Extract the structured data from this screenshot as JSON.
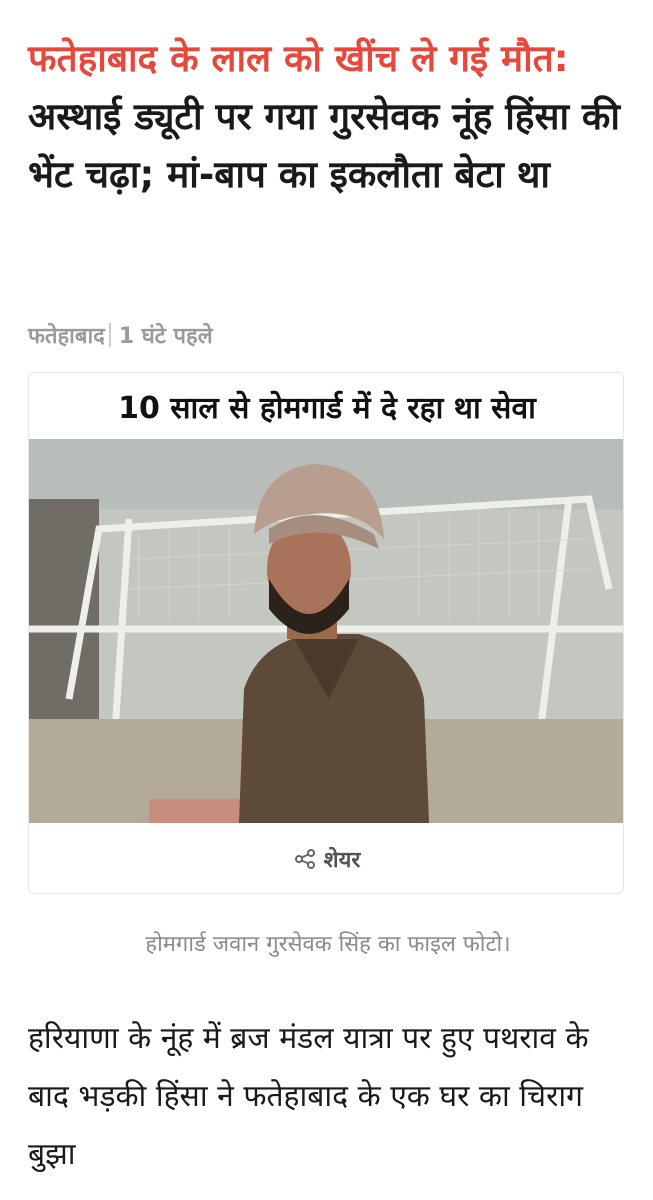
{
  "headline": {
    "highlight": "फतेहाबाद के लाल को खींच ले गई मौत:",
    "rest": "अस्थाई ड्यूटी पर गया गुरसेवक नूंह हिंसा की भेंट चढ़ा; मां-बाप का इकलौता बेटा था"
  },
  "meta": {
    "location": "फतेहाबाद",
    "time": "1 घंटे पहले"
  },
  "photo": {
    "banner": "10 साल से होमगार्ड में दे रहा था सेवा"
  },
  "share": {
    "label": "शेयर",
    "icon": "share-icon"
  },
  "caption": "होमगार्ड जवान गुरसेवक सिंह का फाइल फोटो।",
  "body": "हरियाणा के नूंह में ब्रज मंडल यात्रा पर हुए पथराव के बाद भड़की हिंसा ने फतेहाबाद के एक घर का चिराग बुझा",
  "colors": {
    "accent": "#e8473b",
    "text": "#1a1a1a",
    "muted": "#9a9a9a"
  }
}
